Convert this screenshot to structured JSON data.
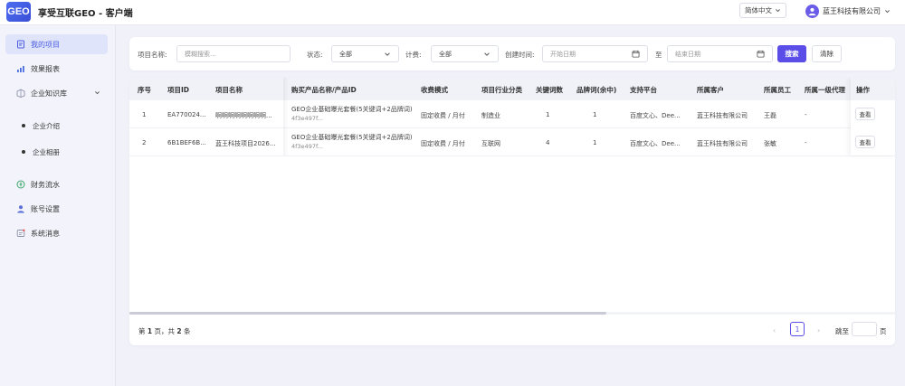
{
  "header": {
    "logo_text": "GEO",
    "title": "享受互联GEO - 客户端",
    "language": "简体中文",
    "company": "蓝王科技有限公司"
  },
  "sidebar": {
    "items": [
      {
        "label": "我的项目",
        "icon": "project-icon",
        "active": true
      },
      {
        "label": "效果报表",
        "icon": "chart-icon"
      },
      {
        "label": "企业知识库",
        "icon": "knowledge-icon",
        "expanded": true
      },
      {
        "label": "财务流水",
        "icon": "finance-icon"
      },
      {
        "label": "账号设置",
        "icon": "user-icon"
      },
      {
        "label": "系统消息",
        "icon": "message-icon"
      }
    ],
    "subitems": [
      {
        "label": "企业介绍"
      },
      {
        "label": "企业相册"
      }
    ]
  },
  "filters": {
    "name_label": "项目名称:",
    "name_placeholder": "模糊搜索...",
    "status_label": "状态:",
    "status_value": "全部",
    "billing_label": "计费:",
    "billing_value": "全部",
    "created_label": "创建时间:",
    "start_placeholder": "开始日期",
    "range_sep": "至",
    "end_placeholder": "结束日期",
    "search_button": "搜索",
    "clear_button": "清除"
  },
  "table": {
    "columns": [
      "序号",
      "项目ID",
      "项目名称",
      "购买产品名称/产品ID",
      "收费模式",
      "项目行业分类",
      "关键词数",
      "品牌词(余中)",
      "支持平台",
      "所属客户",
      "所属员工",
      "所属一级代理",
      "操作"
    ],
    "rows": [
      {
        "index": "1",
        "project_id": "EA770024...",
        "project_name": "啊啊啊啊啊啊啊啊...",
        "product_name": "GEO企业基础曝光套餐(5关键词+2品牌词)",
        "product_id": "4f3e497f...",
        "billing": "固定收费 / 月付",
        "industry": "制造业",
        "keywords": "1",
        "brand_words": "1",
        "platforms": "百度文心、Dee...",
        "customer": "蓝王科技有限公司",
        "employee": "王磊",
        "agent": "-",
        "action": "查看"
      },
      {
        "index": "2",
        "project_id": "6B1BEF6B...",
        "project_name": "蓝王科技项目2026...",
        "product_name": "GEO企业基础曝光套餐(5关键词+2品牌词)",
        "product_id": "4f3e497f...",
        "billing": "固定收费 / 月付",
        "industry": "互联网",
        "keywords": "4",
        "brand_words": "1",
        "platforms": "百度文心、Dee...",
        "customer": "蓝王科技有限公司",
        "employee": "张敏",
        "agent": "-",
        "action": "查看"
      }
    ]
  },
  "pagination": {
    "summary_prefix": "第",
    "page": "1",
    "summary_mid": "页，共",
    "total": "2",
    "summary_suffix": "条",
    "prev": "‹",
    "current": "1",
    "next": "›",
    "goto_label": "跳至",
    "goto_suffix": "页"
  },
  "colors": {
    "accent": "#5b4de8",
    "active_bg": "#dfe4fb"
  }
}
